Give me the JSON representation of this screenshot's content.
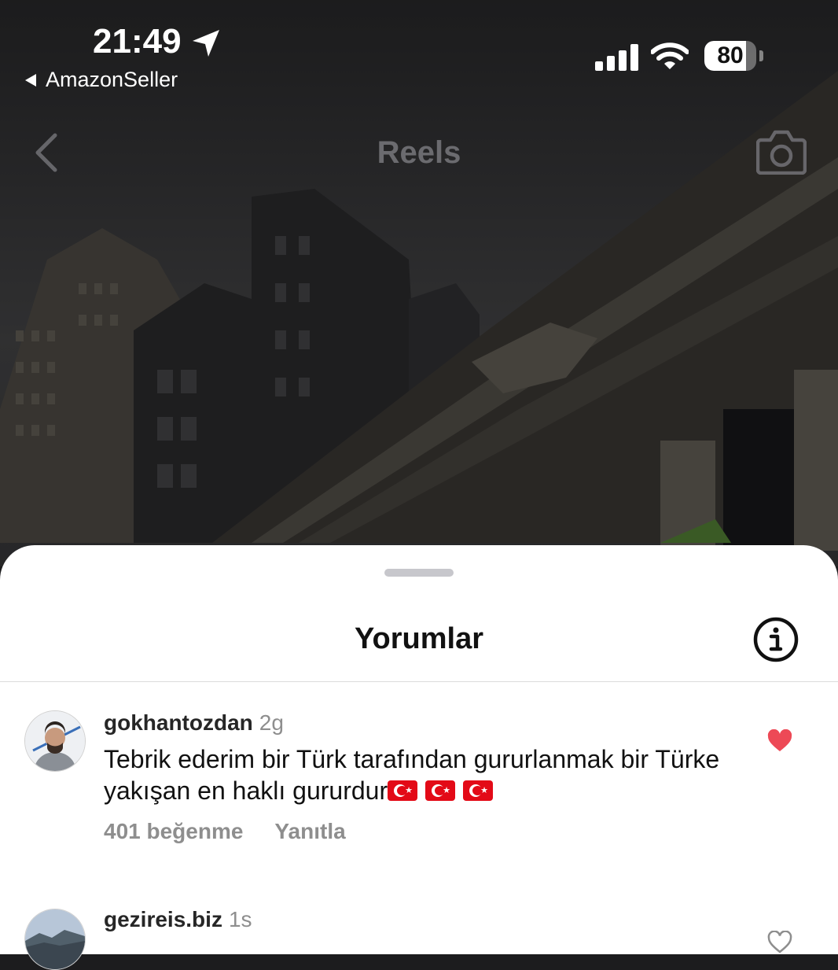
{
  "status_bar": {
    "time": "21:49",
    "back_app": "AmazonSeller",
    "battery": 80
  },
  "header": {
    "title": "Reels"
  },
  "sheet": {
    "title": "Yorumlar"
  },
  "comments": [
    {
      "username": "gokhantozdan",
      "time": "2g",
      "text": "Tebrik ederim bir Türk tarafından gururlanmak bir Türke yakışan en haklı gururdur",
      "flags": 3,
      "likes": "401 beğenme",
      "reply": "Yanıtla",
      "liked": true
    },
    {
      "username": "gezireis.biz",
      "time": "1s",
      "liked": false
    }
  ],
  "colors": {
    "heart_liked": "#ed4956",
    "flag_red": "#e30a17"
  }
}
